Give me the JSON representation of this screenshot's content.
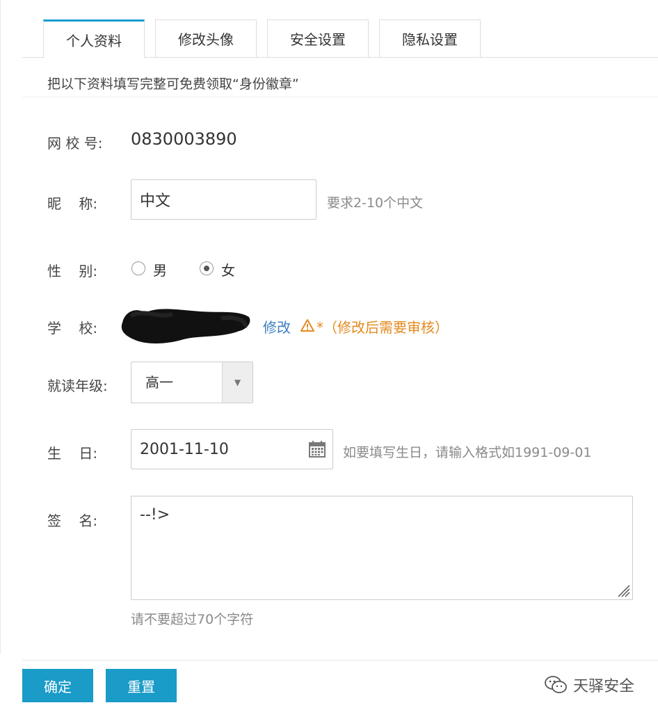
{
  "tabs": [
    {
      "label": "个人资料",
      "active": true
    },
    {
      "label": "修改头像",
      "active": false
    },
    {
      "label": "安全设置",
      "active": false
    },
    {
      "label": "隐私设置",
      "active": false
    }
  ],
  "notice": "把以下资料填写完整可免费领取“身份徽章”",
  "form": {
    "school_id": {
      "label": "网 校 号:",
      "value": "0830003890"
    },
    "nickname": {
      "label": "昵    称:",
      "value": "中文",
      "hint": "要求2-10个中文"
    },
    "gender": {
      "label": "性    别:",
      "options": [
        {
          "label": "男",
          "checked": false
        },
        {
          "label": "女",
          "checked": true
        }
      ]
    },
    "school": {
      "label": "学    校:",
      "edit_link": "修改",
      "warning": "*（修改后需要审核）"
    },
    "grade": {
      "label": "就读年级:",
      "selected": "高一"
    },
    "birthday": {
      "label": "生    日:",
      "value": "2001-11-10",
      "hint": "如要填写生日，请输入格式如1991-09-01"
    },
    "signature": {
      "label": "签    名:",
      "value": "--!>",
      "hint": "请不要超过70个字符"
    }
  },
  "buttons": {
    "confirm": "确定",
    "reset": "重置"
  },
  "watermark": "天驿安全",
  "colors": {
    "accent": "#1a9bc8",
    "link": "#3c7ebf",
    "warning": "#e48a1f"
  }
}
